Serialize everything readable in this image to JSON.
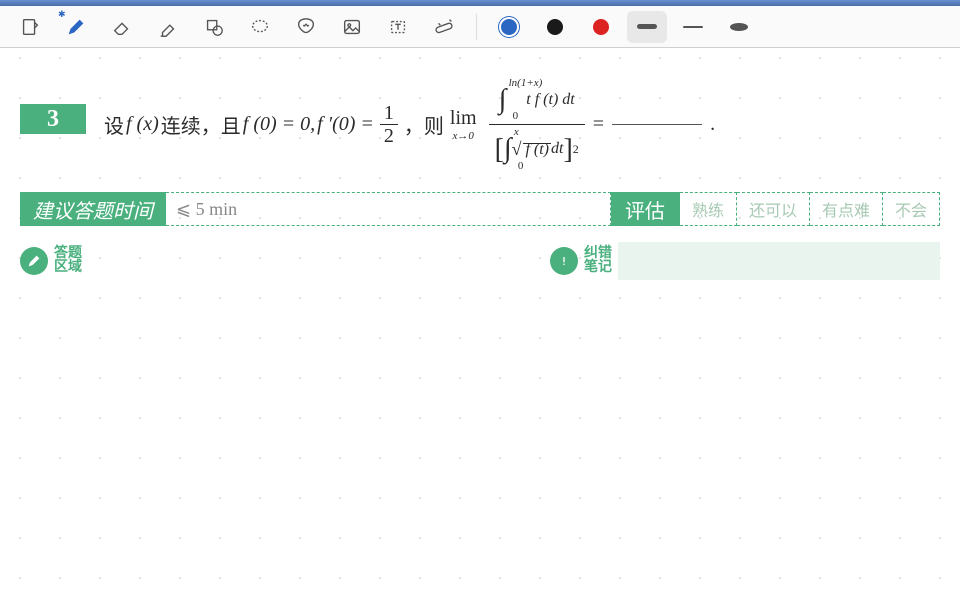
{
  "toolbar": {
    "icons": [
      "book",
      "pen",
      "eraser",
      "marker",
      "shape",
      "lasso",
      "star",
      "image",
      "text",
      "tune"
    ],
    "colors": [
      "#2b66c2",
      "#1a1a1a",
      "#d22",
      "#555",
      "#555",
      "#555"
    ]
  },
  "problem": {
    "number": "3",
    "prefix1": "设 ",
    "fx": "f (x)",
    "cont": " 连续，且 ",
    "f0": "f (0) = 0, ",
    "fp0": "f ′(0) = ",
    "frac_num": "1",
    "frac_den": "2",
    "comma": "，则",
    "lim": "lim",
    "lim_sub": "x→0",
    "num_ulim": "ln(1+x)",
    "num_llim": "0",
    "num_integrand": "t f (t) dt",
    "den_ulim": "x",
    "den_llim": "0",
    "den_rad": "f (t)",
    "den_dt": " dt",
    "sq": "2",
    "equals": " = ",
    "period": "."
  },
  "info": {
    "time_label": "建议答题时间",
    "time_value": "⩽ 5  min",
    "eval_label": "评估",
    "opts": [
      "熟练",
      "还可以",
      "有点难",
      "不会"
    ]
  },
  "sections": {
    "answer_l1": "答题",
    "answer_l2": "区域",
    "notes_l1": "纠错",
    "notes_l2": "笔记"
  }
}
